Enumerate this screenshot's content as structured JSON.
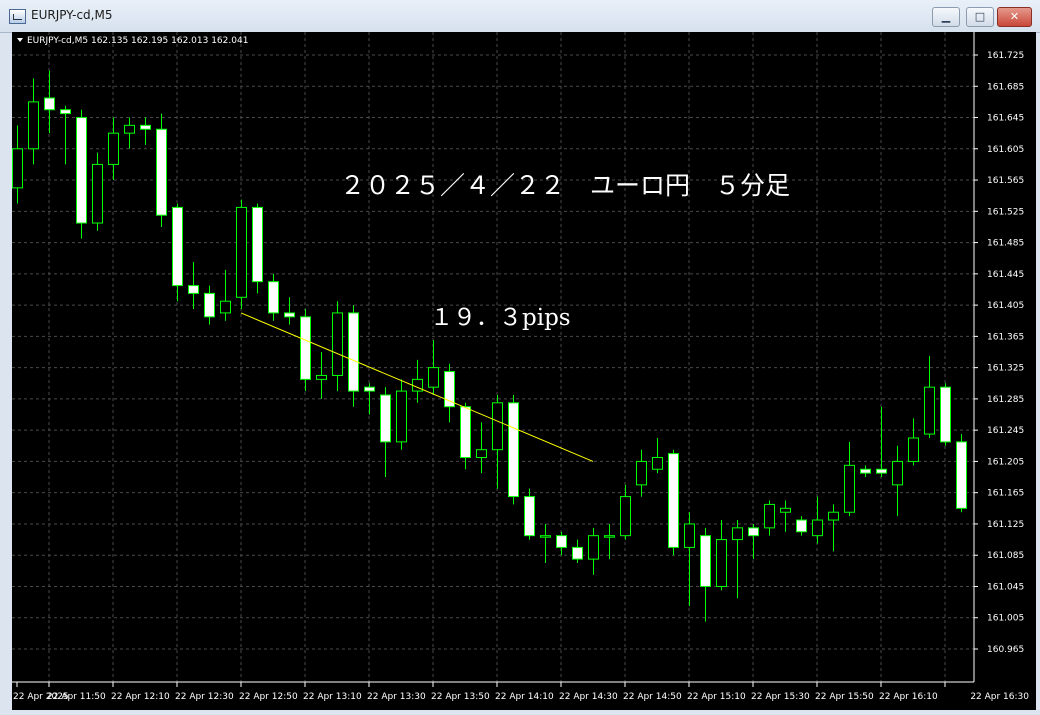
{
  "window": {
    "title": "EURJPY-cd,M5",
    "buttons": {
      "minimize": "▁",
      "maximize": "□",
      "close": "✕"
    }
  },
  "colors": {
    "background": "#000000",
    "grid": "#4a4a4a",
    "bull_fill": "#000000",
    "bear_fill": "#ffffff",
    "candle_outline": "#00ff00",
    "trendline": "#ffff00"
  },
  "chart_data": {
    "type": "candlestick",
    "symbol_info": "EURJPY-cd,M5  162.135 162.195 162.013 162.041",
    "annotations": [
      "２０２５／４／２２　ユーロ円　５分足",
      "１９．３pips"
    ],
    "ylim": [
      160.965,
      161.725
    ],
    "y_ticks": [
      "161.725",
      "161.685",
      "161.645",
      "161.605",
      "161.565",
      "161.525",
      "161.485",
      "161.445",
      "161.405",
      "161.365",
      "161.325",
      "161.285",
      "161.245",
      "161.205",
      "161.165",
      "161.125",
      "161.085",
      "161.045",
      "161.005",
      "160.965"
    ],
    "x_ticks": [
      "22 Apr 2025",
      "22 Apr 11:50",
      "22 Apr 12:10",
      "22 Apr 12:30",
      "22 Apr 12:50",
      "22 Apr 13:10",
      "22 Apr 13:30",
      "22 Apr 13:50",
      "22 Apr 14:10",
      "22 Apr 14:30",
      "22 Apr 14:50",
      "22 Apr 15:10",
      "22 Apr 15:30",
      "22 Apr 15:50",
      "22 Apr 16:10",
      "22 Apr 16:30"
    ],
    "grid": true,
    "candles": [
      [
        161.555,
        161.605,
        161.635,
        161.535
      ],
      [
        161.605,
        161.665,
        161.695,
        161.585
      ],
      [
        161.67,
        161.655,
        161.705,
        161.625
      ],
      [
        161.655,
        161.65,
        161.66,
        161.585
      ],
      [
        161.645,
        161.51,
        161.655,
        161.49
      ],
      [
        161.51,
        161.585,
        161.6,
        161.5
      ],
      [
        161.585,
        161.625,
        161.645,
        161.565
      ],
      [
        161.625,
        161.635,
        161.645,
        161.605
      ],
      [
        161.635,
        161.63,
        161.645,
        161.61
      ],
      [
        161.63,
        161.52,
        161.65,
        161.505
      ],
      [
        161.53,
        161.43,
        161.535,
        161.41
      ],
      [
        161.43,
        161.42,
        161.46,
        161.4
      ],
      [
        161.42,
        161.39,
        161.43,
        161.38
      ],
      [
        161.395,
        161.41,
        161.45,
        161.385
      ],
      [
        161.415,
        161.53,
        161.54,
        161.4
      ],
      [
        161.53,
        161.435,
        161.535,
        161.42
      ],
      [
        161.435,
        161.395,
        161.445,
        161.385
      ],
      [
        161.395,
        161.39,
        161.415,
        161.38
      ],
      [
        161.39,
        161.31,
        161.4,
        161.295
      ],
      [
        161.31,
        161.315,
        161.345,
        161.285
      ],
      [
        161.315,
        161.395,
        161.41,
        161.295
      ],
      [
        161.395,
        161.295,
        161.405,
        161.275
      ],
      [
        161.3,
        161.295,
        161.305,
        161.265
      ],
      [
        161.29,
        161.23,
        161.3,
        161.185
      ],
      [
        161.23,
        161.295,
        161.31,
        161.22
      ],
      [
        161.295,
        161.31,
        161.335,
        161.28
      ],
      [
        161.3,
        161.325,
        161.36,
        161.29
      ],
      [
        161.32,
        161.275,
        161.33,
        161.255
      ],
      [
        161.275,
        161.21,
        161.28,
        161.195
      ],
      [
        161.21,
        161.22,
        161.255,
        161.19
      ],
      [
        161.22,
        161.28,
        161.29,
        161.17
      ],
      [
        161.28,
        161.16,
        161.29,
        161.15
      ],
      [
        161.16,
        161.11,
        161.17,
        161.105
      ],
      [
        161.11,
        161.11,
        161.125,
        161.075
      ],
      [
        161.11,
        161.095,
        161.115,
        161.085
      ],
      [
        161.095,
        161.08,
        161.105,
        161.075
      ],
      [
        161.08,
        161.11,
        161.12,
        161.06
      ],
      [
        161.11,
        161.11,
        161.125,
        161.08
      ],
      [
        161.11,
        161.16,
        161.175,
        161.105
      ],
      [
        161.175,
        161.205,
        161.22,
        161.16
      ],
      [
        161.195,
        161.21,
        161.235,
        161.19
      ],
      [
        161.215,
        161.095,
        161.22,
        161.085
      ],
      [
        161.095,
        161.125,
        161.14,
        161.02
      ],
      [
        161.11,
        161.045,
        161.12,
        161.0
      ],
      [
        161.045,
        161.105,
        161.13,
        161.04
      ],
      [
        161.105,
        161.12,
        161.13,
        161.03
      ],
      [
        161.12,
        161.11,
        161.125,
        161.08
      ],
      [
        161.12,
        161.15,
        161.155,
        161.11
      ],
      [
        161.14,
        161.145,
        161.155,
        161.115
      ],
      [
        161.13,
        161.115,
        161.135,
        161.11
      ],
      [
        161.11,
        161.13,
        161.16,
        161.1
      ],
      [
        161.13,
        161.14,
        161.15,
        161.09
      ],
      [
        161.14,
        161.2,
        161.23,
        161.135
      ],
      [
        161.195,
        161.19,
        161.2,
        161.185
      ],
      [
        161.195,
        161.19,
        161.275,
        161.185
      ],
      [
        161.175,
        161.205,
        161.225,
        161.135
      ],
      [
        161.205,
        161.235,
        161.26,
        161.2
      ],
      [
        161.24,
        161.3,
        161.34,
        161.235
      ],
      [
        161.3,
        161.23,
        161.305,
        161.225
      ],
      [
        161.23,
        161.145,
        161.24,
        161.14
      ]
    ],
    "trendline": {
      "start": [
        "22 Apr 12:50",
        161.395
      ],
      "end": [
        "22 Apr 14:40",
        161.205
      ]
    }
  }
}
